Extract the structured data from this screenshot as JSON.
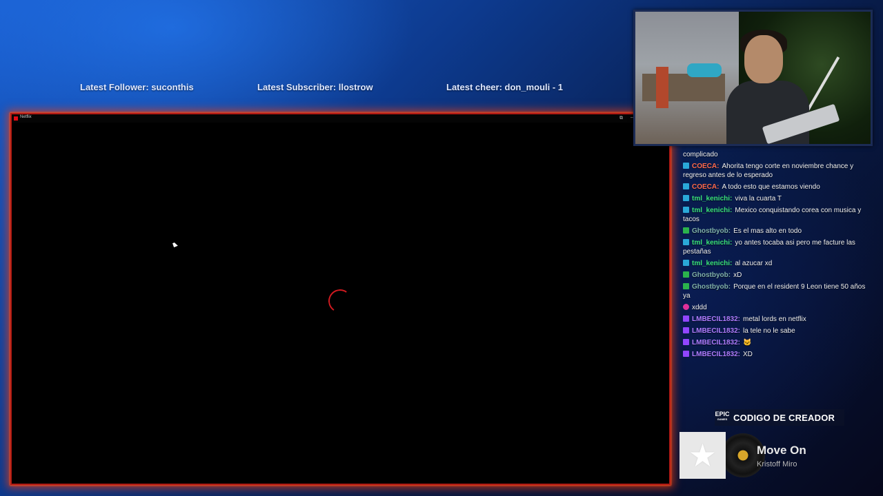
{
  "stream_info": {
    "latest_follower": "Latest Follower: suconthis",
    "latest_subscriber": "Latest Subscriber: llostrow",
    "latest_cheer": "Latest cheer: don_mouli - 1"
  },
  "app_window": {
    "title": "Netflix",
    "controls": {
      "fullscreen": "⧉",
      "minimize": "─",
      "maximize": "□",
      "restore": "⧠",
      "close": "✕"
    },
    "loading_icon": "spinner-icon"
  },
  "chat": {
    "messages": [
      {
        "badge": "",
        "user": "",
        "user_color": "#ffffff",
        "text": "complicado"
      },
      {
        "badge": "vip",
        "user": "COECA:",
        "user_color": "#ff6a4d",
        "text": "Ahorita tengo corte en noviembre chance y regreso antes de lo esperado"
      },
      {
        "badge": "vip",
        "user": "COECA:",
        "user_color": "#ff6a4d",
        "text": "A todo esto que estamos viendo"
      },
      {
        "badge": "vip",
        "user": "tml_kenichi:",
        "user_color": "#39e07a",
        "text": "viva la cuarta T"
      },
      {
        "badge": "vip",
        "user": "tml_kenichi:",
        "user_color": "#39e07a",
        "text": "Mexico conquistando corea con musica y tacos"
      },
      {
        "badge": "mod",
        "user": "Ghostbyob:",
        "user_color": "#7fb0a8",
        "text": "Es el mas alto en todo"
      },
      {
        "badge": "vip",
        "user": "tml_kenichi:",
        "user_color": "#39e07a",
        "text": "yo antes tocaba asi pero me facture las pestañas"
      },
      {
        "badge": "vip",
        "user": "tml_kenichi:",
        "user_color": "#39e07a",
        "text": "al azucar xd"
      },
      {
        "badge": "mod",
        "user": "Ghostbyob:",
        "user_color": "#7fb0a8",
        "text": "xD"
      },
      {
        "badge": "mod",
        "user": "Ghostbyob:",
        "user_color": "#7fb0a8",
        "text": "Porque en el resident 9 Leon tiene 50 años ya"
      },
      {
        "badge": "pink",
        "user": "",
        "user_color": "#b01820",
        "text": "xddd"
      },
      {
        "badge": "sub",
        "user": "LMBECIL1832:",
        "user_color": "#b07cff",
        "text": "metal lords en netflix"
      },
      {
        "badge": "sub",
        "user": "LMBECIL1832:",
        "user_color": "#b07cff",
        "text": "la tele no le sabe"
      },
      {
        "badge": "sub",
        "user": "LMBECIL1832:",
        "user_color": "#b07cff",
        "text": "🐱"
      },
      {
        "badge": "sub",
        "user": "LMBECIL1832:",
        "user_color": "#b07cff",
        "text": "XD"
      }
    ]
  },
  "creator_code": {
    "logo_text": "EPIC",
    "logo_subtext": "GAMES",
    "label": "CODIGO DE CREADOR"
  },
  "now_playing": {
    "album_icon": "star-icon",
    "title": "Move On",
    "artist": "Kristoff Miro"
  }
}
